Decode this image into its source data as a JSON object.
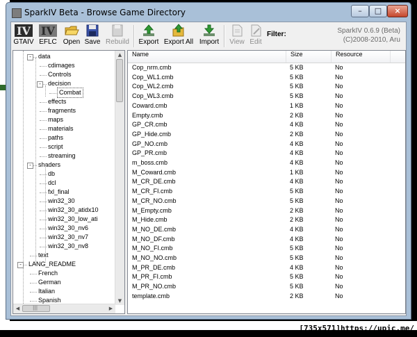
{
  "window": {
    "title": "SparkIV Beta - Browse Game Directory"
  },
  "window_controls": {
    "minimize": "–",
    "maximize": "□",
    "close": "×"
  },
  "toolbar": {
    "buttons": [
      {
        "label": "GTAIV",
        "icon": "gtaiv-logo-icon",
        "enabled": true
      },
      {
        "label": "EFLC",
        "icon": "eflc-logo-icon",
        "enabled": true
      },
      {
        "label": "Open",
        "icon": "folder-open-icon",
        "enabled": true
      },
      {
        "label": "Save",
        "icon": "floppy-disk-icon",
        "enabled": true
      },
      {
        "label": "Rebuild",
        "icon": "rebuild-icon",
        "enabled": false
      },
      {
        "label": "Export",
        "icon": "export-arrow-icon",
        "enabled": true
      },
      {
        "label": "Export All",
        "icon": "export-all-icon",
        "enabled": true
      },
      {
        "label": "Import",
        "icon": "import-arrow-icon",
        "enabled": true
      },
      {
        "label": "View",
        "icon": "document-view-icon",
        "enabled": false
      },
      {
        "label": "Edit",
        "icon": "document-edit-icon",
        "enabled": false
      }
    ],
    "logo_text_gtaiv": "IV",
    "logo_text_eflc": "IV",
    "filter_label": "Filter:",
    "version_line1": "SparkIV 0.6.9 (Beta)",
    "version_line2": "(C)2008-2010, Aru"
  },
  "tree": {
    "nodes": [
      {
        "label": "data",
        "level": 1,
        "toggle": "-"
      },
      {
        "label": "cdimages",
        "level": 2
      },
      {
        "label": "Controls",
        "level": 2
      },
      {
        "label": "decision",
        "level": 2,
        "toggle": "-"
      },
      {
        "label": "Combat",
        "level": 3,
        "selected": true
      },
      {
        "label": "effects",
        "level": 2
      },
      {
        "label": "fragments",
        "level": 2
      },
      {
        "label": "maps",
        "level": 2
      },
      {
        "label": "materials",
        "level": 2
      },
      {
        "label": "paths",
        "level": 2
      },
      {
        "label": "script",
        "level": 2
      },
      {
        "label": "streaming",
        "level": 2
      },
      {
        "label": "shaders",
        "level": 1,
        "toggle": "-"
      },
      {
        "label": "db",
        "level": 2
      },
      {
        "label": "dcl",
        "level": 2
      },
      {
        "label": "fxl_final",
        "level": 2
      },
      {
        "label": "win32_30",
        "level": 2
      },
      {
        "label": "win32_30_atidx10",
        "level": 2
      },
      {
        "label": "win32_30_low_ati",
        "level": 2
      },
      {
        "label": "win32_30_nv6",
        "level": 2
      },
      {
        "label": "win32_30_nv7",
        "level": 2
      },
      {
        "label": "win32_30_nv8",
        "level": 2
      },
      {
        "label": "text",
        "level": 1
      },
      {
        "label": "LANG_README",
        "level": 0,
        "toggle": "-"
      },
      {
        "label": "French",
        "level": 1
      },
      {
        "label": "German",
        "level": 1
      },
      {
        "label": "Italian",
        "level": 1
      },
      {
        "label": "Spanish",
        "level": 1
      }
    ]
  },
  "file_list": {
    "columns": [
      "Name",
      "Size",
      "Resource"
    ],
    "rows": [
      [
        "Cop_nrm.cmb",
        "5 KB",
        "No"
      ],
      [
        "Cop_WL1.cmb",
        "5 KB",
        "No"
      ],
      [
        "Cop_WL2.cmb",
        "5 KB",
        "No"
      ],
      [
        "Cop_WL3.cmb",
        "5 KB",
        "No"
      ],
      [
        "Coward.cmb",
        "1 KB",
        "No"
      ],
      [
        "Empty.cmb",
        "2 KB",
        "No"
      ],
      [
        "GP_CR.cmb",
        "4 KB",
        "No"
      ],
      [
        "GP_Hide.cmb",
        "2 KB",
        "No"
      ],
      [
        "GP_NO.cmb",
        "4 KB",
        "No"
      ],
      [
        "GP_PR.cmb",
        "4 KB",
        "No"
      ],
      [
        "m_boss.cmb",
        "4 KB",
        "No"
      ],
      [
        "M_Coward.cmb",
        "1 KB",
        "No"
      ],
      [
        "M_CR_DE.cmb",
        "4 KB",
        "No"
      ],
      [
        "M_CR_FI.cmb",
        "5 KB",
        "No"
      ],
      [
        "M_CR_NO.cmb",
        "5 KB",
        "No"
      ],
      [
        "M_Empty.cmb",
        "2 KB",
        "No"
      ],
      [
        "M_Hide.cmb",
        "2 KB",
        "No"
      ],
      [
        "M_NO_DE.cmb",
        "4 KB",
        "No"
      ],
      [
        "M_NO_DF.cmb",
        "4 KB",
        "No"
      ],
      [
        "M_NO_FI.cmb",
        "5 KB",
        "No"
      ],
      [
        "M_NO_NO.cmb",
        "5 KB",
        "No"
      ],
      [
        "M_PR_DE.cmb",
        "4 KB",
        "No"
      ],
      [
        "M_PR_FI.cmb",
        "5 KB",
        "No"
      ],
      [
        "M_PR_NO.cmb",
        "5 KB",
        "No"
      ],
      [
        "template.cmb",
        "2 KB",
        "No"
      ]
    ]
  },
  "watermark": "[735x571]https://upic.me/"
}
